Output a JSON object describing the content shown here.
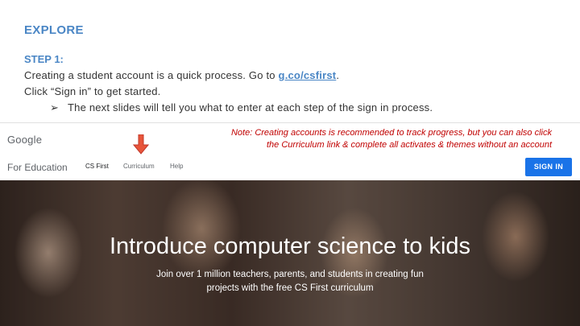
{
  "slide": {
    "title": "EXPLORE",
    "step_heading": "STEP 1:",
    "line1_text": "Creating a student account is a quick process. Go to ",
    "line1_link": "g.co/csfirst",
    "line1_end": ".",
    "line2": "Click “Sign in” to get started.",
    "bullet_glyph": "➢",
    "bullet": "The next slides will tell you what to enter at each step of the sign in process.",
    "note_line1": "Note: Creating accounts is recommended to track progress, but you can also click",
    "note_line2": "the Curriculum link & complete all activates & themes without an account"
  },
  "site": {
    "logo": "Google",
    "for_education": "For Education",
    "nav": [
      "CS First",
      "Curriculum",
      "Help"
    ],
    "signin": "SIGN IN",
    "hero_title": "Introduce computer science to kids",
    "hero_subtitle": "Join over 1 million teachers, parents, and students in creating fun projects with the free CS First curriculum"
  },
  "colors": {
    "accent": "#4a86c5",
    "note": "#c00000",
    "signin_bg": "#1a73e8",
    "arrow": "#e8553a"
  }
}
